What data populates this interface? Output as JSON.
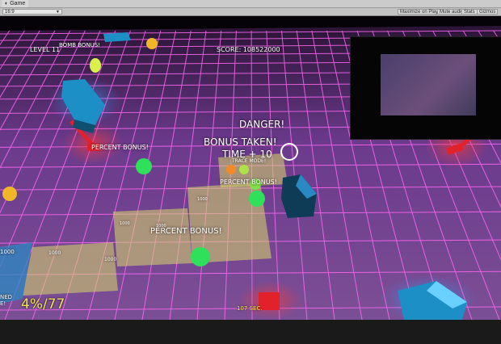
{
  "window": {
    "tab_title": "Game",
    "aspect": "16:9"
  },
  "toolbar": {
    "buttons": [
      "Maximize on Play",
      "Mute audio",
      "Stats",
      "Gizmos"
    ]
  },
  "hud": {
    "level": "LEVEL 11",
    "score": "SCORE: 108522000",
    "percent": "4%/77",
    "time": "107 SEC."
  },
  "popups": {
    "bomb": "BOMB BONUS!",
    "danger": "DANGER!",
    "bonus_taken": "BONUS TAKEN!",
    "time_bonus": "TIME + 10",
    "trace": "TRACE MODE!",
    "percent_left": "PERCENT BONUS!",
    "percent_right": "PERCENT BONUS!",
    "percent_center": "PERCENT BONUS!"
  },
  "cells": [
    "1000",
    "1000",
    "1000",
    "1000",
    "1000",
    "1000"
  ],
  "left_edge_text": [
    "NED",
    "E!"
  ],
  "colors": {
    "grid_line": "#ff5cf0",
    "grid_floor": "#7b3f9a",
    "claimed": "#d9d86a",
    "hud_yellow": "#f0e64a",
    "enemy_blue": "#1d8fc7",
    "player_green": "#2ee05a",
    "red_marker": "#e1222a"
  }
}
